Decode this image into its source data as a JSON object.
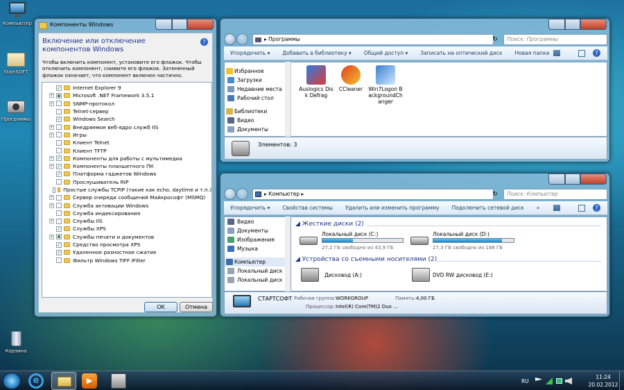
{
  "desktop": {
    "icons": [
      {
        "label": "Компьютер",
        "icon": "computer-icon"
      },
      {
        "label": "StartSOFT",
        "icon": "folder-icon"
      },
      {
        "label": "Программы",
        "icon": "camera-icon"
      },
      {
        "label": "Корзина",
        "icon": "recycle-bin-icon"
      }
    ]
  },
  "features_dialog": {
    "title": "Компоненты Windows",
    "heading": "Включение или отключение компонентов Windows",
    "description": "Чтобы включить компонент, установите его флажок. Чтобы отключить компонент, снимите его флажок. Затененный флажок означает, что компонент включен частично.",
    "items": [
      {
        "label": "Internet Explorer 9",
        "checked": true,
        "expandable": false
      },
      {
        "label": "Microsoft .NET Framework 3.5.1",
        "checked": "partial",
        "expandable": true
      },
      {
        "label": "SNMP-протокол",
        "checked": false,
        "expandable": true
      },
      {
        "label": "Telnet-сервер",
        "checked": false,
        "expandable": false
      },
      {
        "label": "Windows Search",
        "checked": true,
        "expandable": false
      },
      {
        "label": "Внедряемое веб-ядро служб IIS",
        "checked": false,
        "expandable": true
      },
      {
        "label": "Игры",
        "checked": false,
        "expandable": true
      },
      {
        "label": "Клиент Telnet",
        "checked": false,
        "expandable": false
      },
      {
        "label": "Клиент TFTP",
        "checked": false,
        "expandable": false
      },
      {
        "label": "Компоненты для работы с мультимедиа",
        "checked": true,
        "expandable": true
      },
      {
        "label": "Компоненты планшетного ПК",
        "checked": true,
        "expandable": true
      },
      {
        "label": "Платформа гаджетов Windows",
        "checked": true,
        "expandable": false
      },
      {
        "label": "Прослушиватель RIP",
        "checked": false,
        "expandable": false
      },
      {
        "label": "Простые службы TCPIP (такие как echo, daytime и т.п.)",
        "checked": false,
        "expandable": false
      },
      {
        "label": "Сервер очереди сообщений Майкрософт (MSMQ)",
        "checked": false,
        "expandable": true
      },
      {
        "label": "Служба активации Windows",
        "checked": false,
        "expandable": true
      },
      {
        "label": "Служба индексирования",
        "checked": false,
        "expandable": false
      },
      {
        "label": "Службы IIS",
        "checked": false,
        "expandable": true
      },
      {
        "label": "Службы XPS",
        "checked": true,
        "expandable": false
      },
      {
        "label": "Службы печати и документов",
        "checked": "partial",
        "expandable": true
      },
      {
        "label": "Средство просмотра XPS",
        "checked": true,
        "expandable": false
      },
      {
        "label": "Удаленное разностное сжатие",
        "checked": true,
        "expandable": false
      },
      {
        "label": "Фильтр Windows TIFF IFilter",
        "checked": false,
        "expandable": false
      }
    ],
    "ok_label": "OK",
    "cancel_label": "Отмена"
  },
  "programs_window": {
    "address": "Программы",
    "search_placeholder": "Поиск: Программы",
    "commands": [
      "Упорядочить ▾",
      "Добавить в библиотеку ▾",
      "Общий доступ ▾",
      "Записать на оптический диск",
      "Новая папка"
    ],
    "nav": [
      {
        "label": "Избранное",
        "icon": "star-icon"
      },
      {
        "label": "Загрузки",
        "icon": "downloads-icon"
      },
      {
        "label": "Недавние места",
        "icon": "recent-places-icon"
      },
      {
        "label": "Рабочий стол",
        "icon": "desktop-icon"
      },
      {
        "label": "Библиотеки",
        "icon": "libraries-icon"
      },
      {
        "label": "Видео",
        "icon": "video-icon"
      },
      {
        "label": "Документы",
        "icon": "documents-icon"
      }
    ],
    "files": [
      {
        "label": "Auslogics Disk Defrag",
        "icon": "auslogics-icon"
      },
      {
        "label": "CCleaner",
        "icon": "ccleaner-icon"
      },
      {
        "label": "Win7Logon BackgroundChanger",
        "icon": "logon-changer-icon"
      }
    ],
    "status": "Элементов: 3"
  },
  "computer_window": {
    "address": "Компьютер",
    "search_placeholder": "Поиск: Компьютер",
    "commands": [
      "Упорядочить ▾",
      "Свойства системы",
      "Удалить или изменить программу",
      "Подключить сетевой диск",
      "»"
    ],
    "nav": [
      {
        "label": "Видео",
        "icon": "video-icon"
      },
      {
        "label": "Документы",
        "icon": "documents-icon"
      },
      {
        "label": "Изображения",
        "icon": "images-icon"
      },
      {
        "label": "Музыка",
        "icon": "music-icon"
      },
      {
        "label": "Компьютер",
        "icon": "computer-icon"
      },
      {
        "label": "Локальный диск",
        "icon": "drive-icon"
      },
      {
        "label": "Локальный диск",
        "icon": "drive-icon"
      }
    ],
    "hdd_group": "Жесткие диски (2)",
    "drives": [
      {
        "name": "Локальный диск (C:)",
        "free": "27,2 ГБ свободно из 43,9 ГБ",
        "used_fraction": 0.38
      },
      {
        "name": "Локальный диск (D:)",
        "free": "27,3 ГБ свободно из 188 ГБ",
        "used_fraction": 0.855
      }
    ],
    "removable_group": "Устройства со съемными носителями (2)",
    "removable": [
      {
        "name": "Дисковод (A:)",
        "icon": "floppy-icon"
      },
      {
        "name": "DVD RW дисковод (E:)",
        "icon": "dvd-icon"
      }
    ],
    "details": {
      "name": "СТАРТСОФТ",
      "workgroup_label": "Рабочая группа:",
      "workgroup": "WORKGROUP",
      "memory_label": "Память:",
      "memory": "4,00 ГБ",
      "cpu_label": "Процессор:",
      "cpu": "Intel(R) Core(TM)2 Duo ..."
    }
  },
  "taskbar": {
    "lang": "RU",
    "time": "11:24",
    "date": "20.02.2012"
  }
}
